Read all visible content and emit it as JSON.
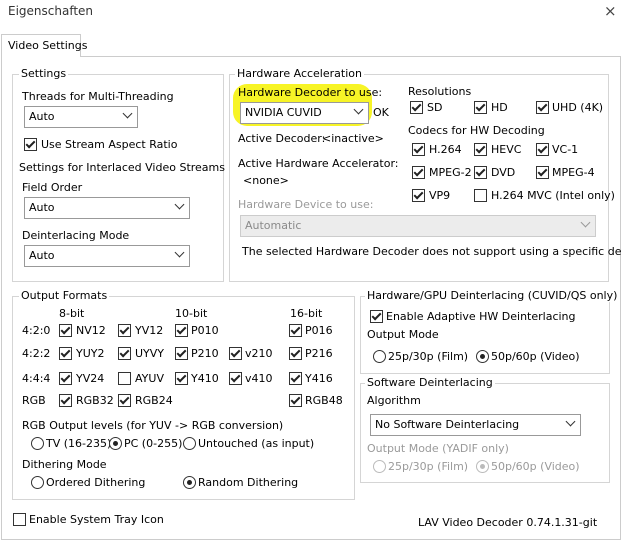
{
  "window": {
    "title": "Eigenschaften",
    "close_glyph": "×"
  },
  "tab": {
    "label": "Video Settings"
  },
  "settings": {
    "group_label": "Settings",
    "threads_label": "Threads for Multi-Threading",
    "threads_value": "Auto",
    "stream_aspect_label": "Use Stream Aspect Ratio",
    "interlaced_label": "Settings for Interlaced Video Streams",
    "field_order_label": "Field Order",
    "field_order_value": "Auto",
    "deint_mode_label": "Deinterlacing Mode",
    "deint_mode_value": "Auto"
  },
  "hw": {
    "group_label": "Hardware Acceleration",
    "decoder_label": "Hardware Decoder to use:",
    "decoder_value": "NVIDIA CUVID",
    "ok_label": "OK",
    "active_decoder_label": "Active Decoder:",
    "active_decoder_value": "<inactive>",
    "active_accel_label": "Active Hardware Accelerator:",
    "active_accel_value": "<none>",
    "device_label": "Hardware Device to use:",
    "device_value": "Automatic",
    "note": "The selected Hardware Decoder does not support using a specific device.",
    "resolutions_label": "Resolutions",
    "res": {
      "sd": "SD",
      "hd": "HD",
      "uhd": "UHD (4K)"
    },
    "codecs_label": "Codecs for HW Decoding",
    "codecs": {
      "h264": "H.264",
      "hevc": "HEVC",
      "vc1": "VC-1",
      "mpeg2": "MPEG-2",
      "dvd": "DVD",
      "mpeg4": "MPEG-4",
      "vp9": "VP9",
      "h264mvc": "H.264 MVC (Intel only)"
    }
  },
  "output": {
    "group_label": "Output Formats",
    "h8": "8-bit",
    "h10": "10-bit",
    "h16": "16-bit",
    "r420": "4:2:0",
    "r422": "4:2:2",
    "r444": "4:4:4",
    "rrgb": "RGB",
    "f": {
      "nv12": "NV12",
      "yv12": "YV12",
      "p010": "P010",
      "p016": "P016",
      "yuy2": "YUY2",
      "uyvy": "UYVY",
      "p210": "P210",
      "v210": "v210",
      "p216": "P216",
      "yv24": "YV24",
      "ayuv": "AYUV",
      "y410": "Y410",
      "v410": "v410",
      "y416": "Y416",
      "rgb32": "RGB32",
      "rgb24": "RGB24",
      "rgb48": "RGB48"
    },
    "levels_label": "RGB Output levels (for YUV -> RGB conversion)",
    "levels": {
      "tv": "TV (16-235)",
      "pc": "PC (0-255)",
      "untouched": "Untouched (as input)"
    },
    "dither_label": "Dithering Mode",
    "dither": {
      "ordered": "Ordered Dithering",
      "random": "Random Dithering"
    }
  },
  "hwdeint": {
    "group_label": "Hardware/GPU Deinterlacing (CUVID/QS only)",
    "enable_label": "Enable Adaptive HW Deinterlacing",
    "output_mode_label": "Output Mode",
    "opt25": "25p/30p (Film)",
    "opt50": "50p/60p (Video)"
  },
  "swdeint": {
    "group_label": "Software Deinterlacing",
    "algorithm_label": "Algorithm",
    "algorithm_value": "No Software Deinterlacing",
    "output_mode_label": "Output Mode (YADIF only)",
    "opt25": "25p/30p (Film)",
    "opt50": "50p/60p (Video)"
  },
  "footer": {
    "tray_label": "Enable System Tray Icon",
    "version": "LAV Video Decoder 0.74.1.31-git"
  }
}
